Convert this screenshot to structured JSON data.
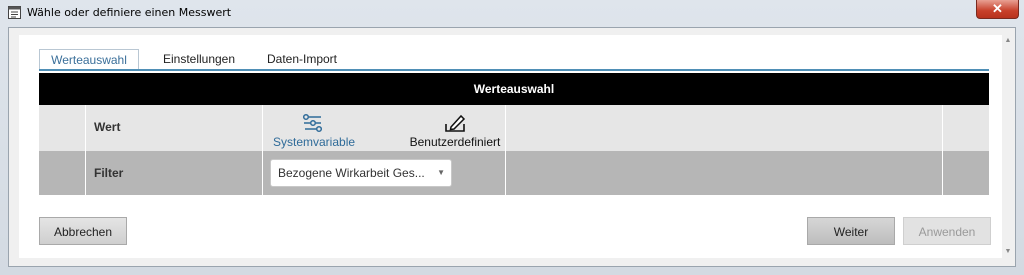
{
  "window": {
    "title": "Wähle oder definiere einen Messwert",
    "close_label": "✕"
  },
  "tabs": [
    {
      "label": "Werteauswahl",
      "active": true
    },
    {
      "label": "Einstellungen",
      "active": false
    },
    {
      "label": "Daten-Import",
      "active": false
    }
  ],
  "grid": {
    "header": "Werteauswahl",
    "row_wert": {
      "label": "Wert",
      "options": [
        {
          "label": "Systemvariable",
          "icon": "system-variable-icon",
          "selected": true
        },
        {
          "label": "Benutzerdefiniert",
          "icon": "edit-pen-icon",
          "selected": false
        }
      ]
    },
    "row_filter": {
      "label": "Filter",
      "select_value": "Bezogene Wirkarbeit Ges..."
    }
  },
  "buttons": {
    "cancel": "Abbrechen",
    "next": "Weiter",
    "apply": "Anwenden"
  },
  "colors": {
    "accent": "#3a6f9a",
    "header_bg": "#000000",
    "close_red": "#c7402a"
  }
}
